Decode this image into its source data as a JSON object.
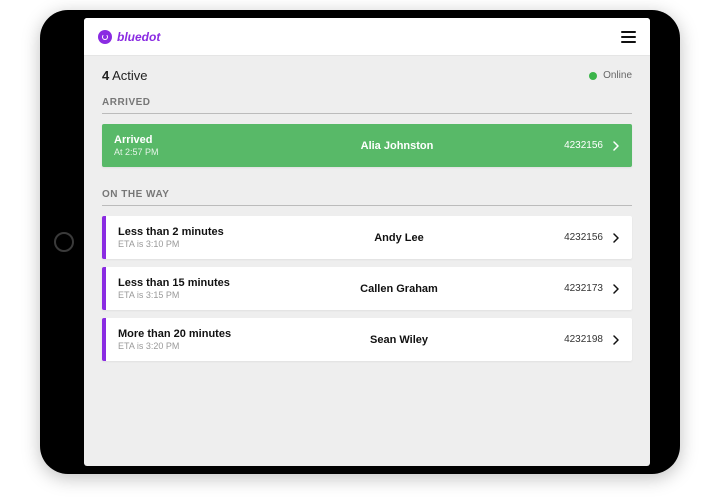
{
  "brand": {
    "name": "bluedot"
  },
  "status": {
    "active_prefix": "4",
    "active_suffix": "Active",
    "online_label": "Online"
  },
  "sections": {
    "arrived_title": "ARRIVED",
    "ontheway_title": "ON THE WAY"
  },
  "arrived": [
    {
      "status_line1": "Arrived",
      "status_line2": "At 2:57 PM",
      "name": "Alia Johnston",
      "id": "4232156"
    }
  ],
  "ontheway": [
    {
      "status_line1": "Less than 2 minutes",
      "status_line2": "ETA is 3:10 PM",
      "name": "Andy Lee",
      "id": "4232156"
    },
    {
      "status_line1": "Less than 15 minutes",
      "status_line2": "ETA is 3:15 PM",
      "name": "Callen Graham",
      "id": "4232173"
    },
    {
      "status_line1": "More than 20 minutes",
      "status_line2": "ETA is 3:20 PM",
      "name": "Sean Wiley",
      "id": "4232198"
    }
  ]
}
